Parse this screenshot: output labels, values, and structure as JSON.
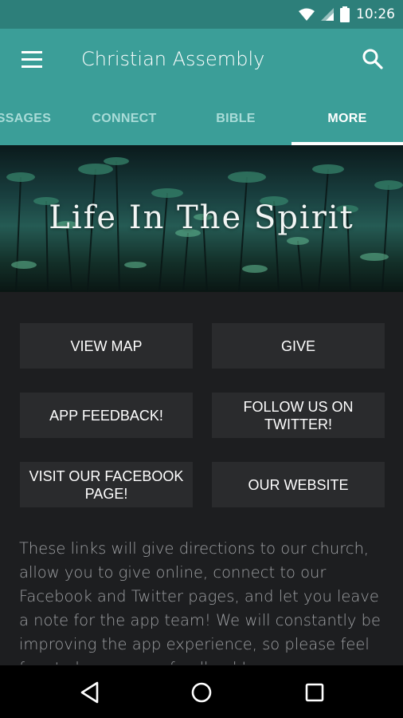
{
  "status_bar": {
    "time": "10:26",
    "icons": [
      "wifi-icon",
      "signal-icon",
      "battery-icon"
    ]
  },
  "app_bar": {
    "title": "Christian Assembly",
    "menu_icon": "menu-icon",
    "search_icon": "search-icon"
  },
  "tabs": [
    {
      "label": "SSAGES",
      "active": false
    },
    {
      "label": "CONNECT",
      "active": false
    },
    {
      "label": "BIBLE",
      "active": false
    },
    {
      "label": "MORE",
      "active": true
    }
  ],
  "banner": {
    "title": "Life In The Spirit"
  },
  "buttons": [
    {
      "label": "VIEW MAP"
    },
    {
      "label": "GIVE"
    },
    {
      "label": "APP FEEDBACK!"
    },
    {
      "label": "FOLLOW US ON TWITTER!"
    },
    {
      "label": "VISIT OUR FACEBOOK PAGE!"
    },
    {
      "label": "OUR WEBSITE"
    }
  ],
  "description": "These links will give directions to our church, allow you to give online, connect to our Facebook and Twitter pages, and let you leave a note for the app team!  We will constantly be improving the app experience, so please feel free to leave some feedback!",
  "nav_bar": {
    "back_icon": "back-icon",
    "home_icon": "home-icon",
    "recents_icon": "recents-icon"
  },
  "colors": {
    "status_bar": "#2d7f7a",
    "app_bar": "#3b9e98",
    "background": "#1d1e20",
    "button": "#2a2b2d"
  }
}
